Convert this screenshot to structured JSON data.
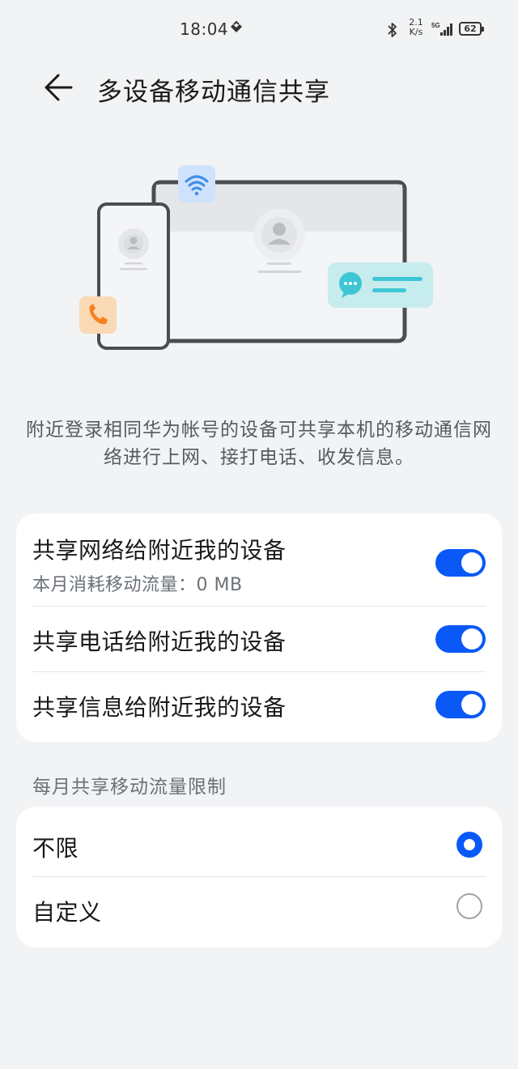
{
  "status_bar": {
    "time": "18:04",
    "net_speed_value": "2.1",
    "net_speed_unit": "K/s",
    "network_type": "5G",
    "battery": "62"
  },
  "header": {
    "title": "多设备移动通信共享"
  },
  "description": "附近登录相同华为帐号的设备可共享本机的移动通信网络进行上网、接打电话、收发信息。",
  "share_settings": [
    {
      "title": "共享网络给附近我的设备",
      "subtitle": "本月消耗移动流量：0 MB",
      "enabled": true
    },
    {
      "title": "共享电话给附近我的设备",
      "enabled": true
    },
    {
      "title": "共享信息给附近我的设备",
      "enabled": true
    }
  ],
  "limit_section": {
    "header": "每月共享移动流量限制",
    "options": [
      {
        "label": "不限",
        "selected": true
      },
      {
        "label": "自定义",
        "selected": false
      }
    ]
  },
  "colors": {
    "accent": "#0a59f7",
    "background": "#f1f3f5",
    "card": "#ffffff",
    "illustration_wifi_badge": "#cfe2fb",
    "illustration_wifi_icon": "#3f8ee8",
    "illustration_phone_badge": "#fad9b5",
    "illustration_phone_icon": "#f5821f",
    "illustration_message_badge": "#c7ecee",
    "illustration_message_icon": "#3ec6d4"
  }
}
